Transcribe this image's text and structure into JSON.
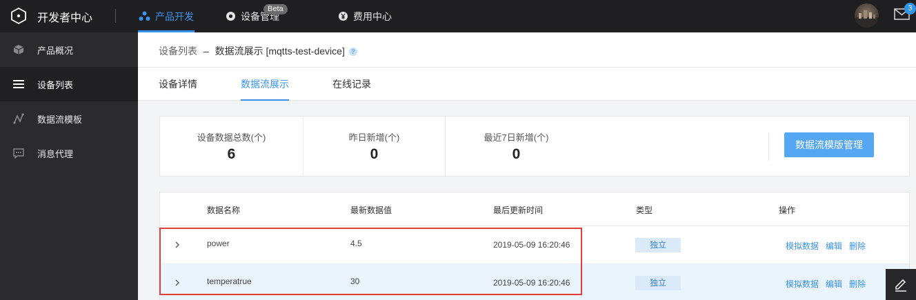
{
  "header": {
    "brand": "开发者中心",
    "nav": [
      {
        "label": "产品开发",
        "icon": "molecule-icon",
        "active": true
      },
      {
        "label": "设备管理",
        "icon": "target-icon",
        "active": false
      },
      {
        "label": "费用中心",
        "icon": "yen-icon",
        "active": false
      }
    ],
    "beta_badge": "Beta",
    "mail_count": "3"
  },
  "sidebar": {
    "items": [
      {
        "label": "产品概况",
        "icon": "cube-icon",
        "active": false
      },
      {
        "label": "设备列表",
        "icon": "list-icon",
        "active": true
      },
      {
        "label": "数据流模板",
        "icon": "flow-icon",
        "active": false
      },
      {
        "label": "消息代理",
        "icon": "chat-icon",
        "active": false
      }
    ]
  },
  "breadcrumb": {
    "parent": "设备列表",
    "separator": "–",
    "current": "数据流展示 [mqtts-test-device]",
    "help": "?"
  },
  "tabs": [
    {
      "label": "设备详情",
      "active": false
    },
    {
      "label": "数据流展示",
      "active": true
    },
    {
      "label": "在线记录",
      "active": false
    }
  ],
  "stats": [
    {
      "label": "设备数据总数(个)",
      "value": "6"
    },
    {
      "label": "昨日新增(个)",
      "value": "0"
    },
    {
      "label": "最近7日新增(个)",
      "value": "0"
    }
  ],
  "manage_button": "数据流模版管理",
  "table": {
    "columns": [
      "数据名称",
      "最新数据值",
      "最后更新时间",
      "类型",
      "操作"
    ],
    "rows": [
      {
        "name": "power",
        "value": "4.5",
        "updated": "2019-05-09 16:20:46",
        "type": "独立",
        "ops": [
          "模拟数据",
          "编辑",
          "删除"
        ]
      },
      {
        "name": "temperatrue",
        "value": "30",
        "updated": "2019-05-09 16:20:46",
        "type": "独立",
        "ops": [
          "模拟数据",
          "编辑",
          "删除"
        ]
      }
    ]
  },
  "colors": {
    "accent": "#3a93f0",
    "topbar": "#1f1f22",
    "sidebar": "#2b2b2e",
    "highlight_box": "#e53c3c",
    "button": "#55a6f3"
  }
}
